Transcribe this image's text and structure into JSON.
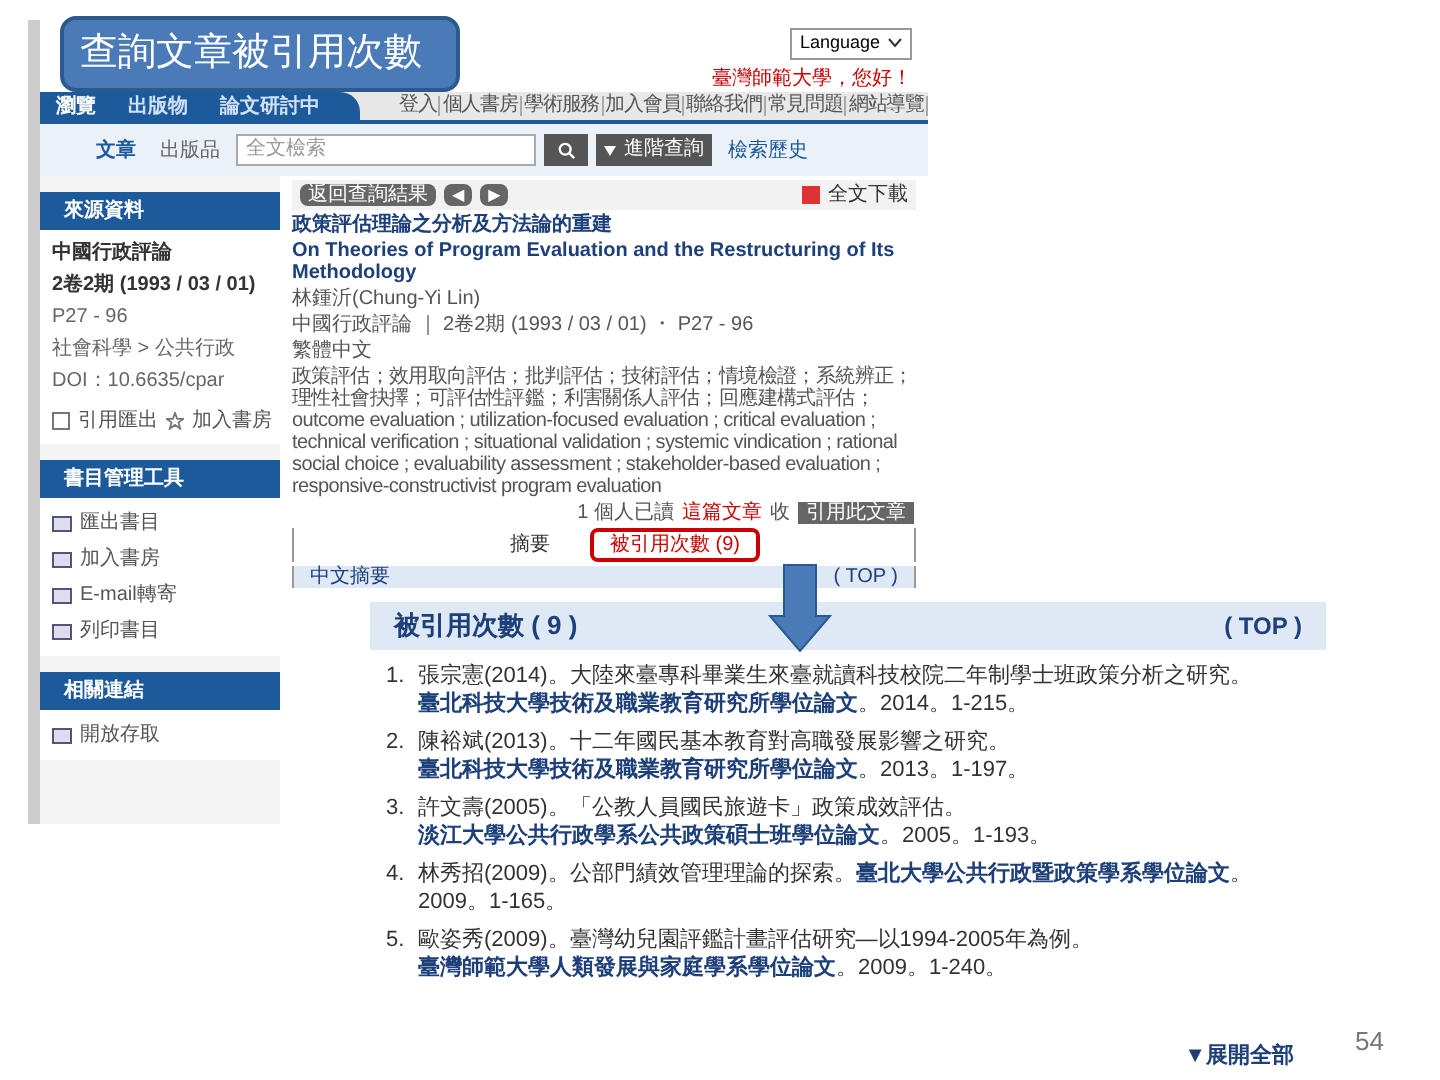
{
  "slide_title": "查詢文章被引用次數",
  "header": {
    "language": "Language",
    "welcome": "臺灣師範大學，您好！"
  },
  "nav": {
    "tabs": [
      {
        "label": "瀏覽",
        "selected": true
      },
      {
        "label": "出版物",
        "selected": false
      },
      {
        "label": "論文研討中",
        "selected": false
      }
    ],
    "links": [
      "登入",
      "個人書房",
      "學術服務",
      "加入會員",
      "聯絡我們",
      "常見問題",
      "網站導覽"
    ]
  },
  "search": {
    "scopes": [
      {
        "label": "文章",
        "selected": true
      },
      {
        "label": "出版品",
        "selected": false
      }
    ],
    "placeholder": "全文檢索",
    "advanced": "進階查詢",
    "history": "檢索歷史"
  },
  "sidebar": [
    {
      "title": "來源資料",
      "items": [
        {
          "kind": "strong",
          "text": "中國行政評論"
        },
        {
          "kind": "strong",
          "text": "2卷2期 (1993 / 03 / 01)"
        },
        {
          "kind": "plain",
          "text": "P27 - 96"
        },
        {
          "kind": "plain",
          "text": "社會科學 > 公共行政"
        },
        {
          "kind": "plain",
          "text": "DOI：10.6635/cpar"
        },
        {
          "kind": "actions",
          "text": "引用匯出",
          "text2": "加入書房"
        }
      ]
    },
    {
      "title": "書目管理工具",
      "items": [
        {
          "kind": "tool",
          "text": "匯出書目"
        },
        {
          "kind": "tool",
          "text": "加入書房"
        },
        {
          "kind": "tool",
          "text": "E-mail轉寄"
        },
        {
          "kind": "tool",
          "text": "列印書目"
        }
      ]
    },
    {
      "title": "相關連結",
      "items": [
        {
          "kind": "tool",
          "text": "開放存取"
        }
      ]
    }
  ],
  "toolbar": {
    "back": "返回查詢結果",
    "prev": "◀",
    "next": "▶",
    "download": "全文下載"
  },
  "article": {
    "title": "政策評估理論之分析及方法論的重建",
    "title_en": "On Theories of Program Evaluation and the Restructuring of Its Methodology",
    "author": "林鍾沂(Chung-Yi Lin)",
    "source": "中國行政評論 ｜ 2卷2期 (1993 / 03 / 01) ・ P27 - 96",
    "language": "繁體中文",
    "keywords": "政策評估；效用取向評估；批判評估；技術評估；情境檢證；系統辨正；理性社會抉擇；可評估性評鑑；利害關係人評估；回應建構式評估；outcome evaluation ; utilization-focused evaluation ; critical evaluation ; technical verification ; situational validation ; systemic vindication ; rational social choice ; evaluability assessment ; stakeholder-based evaluation ; responsive-constructivist program evaluation",
    "readers": "1 個人已讀",
    "readers_link": "這篇文章",
    "readers_tail": "收",
    "cite_button": "引用此文章"
  },
  "content_tabs": [
    {
      "label": "摘要",
      "selected": false
    },
    {
      "label": "被引用次數 (9)",
      "selected": true
    }
  ],
  "abstract_header": "中文摘要",
  "abstract_top": "( TOP )",
  "citations": {
    "title": "被引用次數 ( 9 )",
    "top": "( TOP )",
    "expand": "▼展開全部",
    "items": [
      {
        "number": "1.",
        "text": "張宗憲(2014)。大陸來臺專科畢業生來臺就讀科技校院二年制學士班政策分析之研究。",
        "source": "臺北科技大學技術及職業教育研究所學位論文",
        "tail": "。2014。1-215。"
      },
      {
        "number": "2.",
        "text": "陳裕斌(2013)。十二年國民基本教育對高職發展影響之研究。",
        "source": "臺北科技大學技術及職業教育研究所學位論文",
        "tail": "。2013。1-197。"
      },
      {
        "number": "3.",
        "text": "許文壽(2005)。「公教人員國民旅遊卡」政策成效評估。",
        "source": "淡江大學公共行政學系公共政策碩士班學位論文",
        "tail": "。2005。1-193。"
      },
      {
        "number": "4.",
        "text": "林秀招(2009)。公部門績效管理理論的探索。",
        "source": "臺北大學公共行政暨政策學系學位論文",
        "tail": "。2009。1-165。"
      },
      {
        "number": "5.",
        "text": "歐姿秀(2009)。臺灣幼兒園評鑑計畫評估研究—以1994-2005年為例。",
        "source": "臺灣師範大學人類發展與家庭學系學位論文",
        "tail": "。2009。1-240。"
      }
    ]
  },
  "page_number": "54"
}
